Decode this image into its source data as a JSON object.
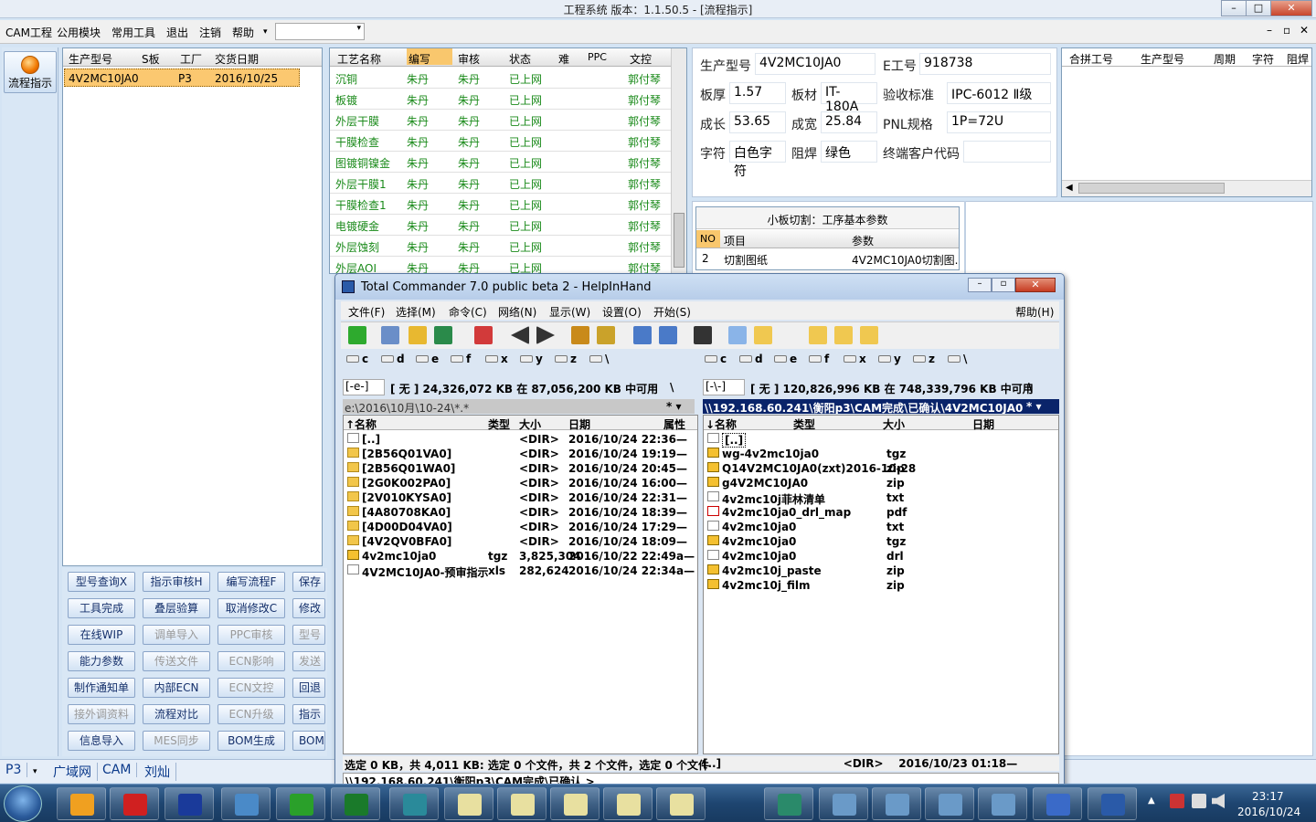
{
  "app": {
    "title": "工程系统   版本：1.1.50.5 - [流程指示]",
    "min": "–",
    "max": "□",
    "close": "✕"
  },
  "menu": [
    "CAM工程",
    "公用模块",
    "常用工具",
    "退出",
    "注销",
    "帮助"
  ],
  "leftnav": {
    "label": "流程指示"
  },
  "order_table": {
    "headers": [
      "生产型号",
      "S板",
      "工厂",
      "交货日期"
    ],
    "row": [
      "4V2MC10JA0",
      "",
      "P3",
      "2016/10/25"
    ]
  },
  "process_table": {
    "headers": [
      "工艺名称",
      "编写",
      "审核",
      "状态",
      "难",
      "PPC",
      "文控"
    ],
    "rows": [
      [
        "沉铜",
        "朱丹",
        "朱丹",
        "已上网",
        "",
        "",
        "郭付琴"
      ],
      [
        "板镀",
        "朱丹",
        "朱丹",
        "已上网",
        "",
        "",
        "郭付琴"
      ],
      [
        "外层干膜",
        "朱丹",
        "朱丹",
        "已上网",
        "",
        "",
        "郭付琴"
      ],
      [
        "干膜检查",
        "朱丹",
        "朱丹",
        "已上网",
        "",
        "",
        "郭付琴"
      ],
      [
        "图镀铜镍金",
        "朱丹",
        "朱丹",
        "已上网",
        "",
        "",
        "郭付琴"
      ],
      [
        "外层干膜1",
        "朱丹",
        "朱丹",
        "已上网",
        "",
        "",
        "郭付琴"
      ],
      [
        "干膜检查1",
        "朱丹",
        "朱丹",
        "已上网",
        "",
        "",
        "郭付琴"
      ],
      [
        "电镀硬金",
        "朱丹",
        "朱丹",
        "已上网",
        "",
        "",
        "郭付琴"
      ],
      [
        "外层蚀刻",
        "朱丹",
        "朱丹",
        "已上网",
        "",
        "",
        "郭付琴"
      ],
      [
        "外层AOI",
        "朱丹",
        "朱丹",
        "已上网",
        "",
        "",
        "郭付琴"
      ]
    ]
  },
  "buttons": [
    [
      "型号查询X",
      "指示审核H",
      "编写流程F",
      "保存信"
    ],
    [
      "工具完成",
      "叠层验算",
      "取消修改C",
      "修改信"
    ],
    [
      "在线WIP",
      "调单导入",
      "PPC审核",
      "型号上"
    ],
    [
      "能力参数",
      "传送文件",
      "ECN影响",
      "发送指"
    ],
    [
      "制作通知单",
      "内部ECN",
      "ECN文控",
      "回退审"
    ],
    [
      "接外调资料",
      "流程对比",
      "ECN升级",
      "指示核"
    ],
    [
      "信息导入",
      "MES同步",
      "BOM生成",
      "BOM参数"
    ]
  ],
  "disabled_buttons": [
    "调单导入",
    "PPC审核",
    "型号上",
    "传送文件",
    "ECN影响",
    "发送指",
    "ECN文控",
    "接外调资料",
    "ECN升级",
    "MES同步"
  ],
  "info": {
    "l_prod": "生产型号",
    "v_prod": "4V2MC10JA0",
    "l_e": "E工号",
    "v_e": "918738",
    "l_thick": "板厚",
    "v_thick": "1.57",
    "l_mat": "板材",
    "v_mat": "IT-180A",
    "l_std": "验收标准",
    "v_std": "IPC-6012 Ⅱ级",
    "l_len": "成长",
    "v_len": "53.65",
    "l_wid": "成宽",
    "v_wid": "25.84",
    "l_pnl": "PNL规格",
    "v_pnl": "1P=72U",
    "l_char": "字符",
    "v_char": "白色字符",
    "l_mask": "阻焊",
    "v_mask": "绿色",
    "l_cust": "终端客户代码",
    "v_cust": ""
  },
  "merge_table": {
    "headers": [
      "合拼工号",
      "生产型号",
      "周期",
      "字符",
      "阻焊"
    ]
  },
  "cut": {
    "title": "小板切割：工序基本参数",
    "headers": [
      "NO",
      "项目",
      "参数"
    ],
    "row": [
      "2",
      "切割图纸",
      "4V2MC10JA0切割图."
    ]
  },
  "bottom_tabs": [
    "P3",
    "广域网",
    "CAM",
    "刘灿"
  ],
  "tc": {
    "title": "Total Commander 7.0 public beta 2 - HelpInHand",
    "menu": [
      "文件(F)",
      "选择(M)",
      "命令(C)",
      "网络(N)",
      "显示(W)",
      "设置(O)",
      "开始(S)"
    ],
    "help": "帮助(H)",
    "left": {
      "drive": "[-e-]",
      "free": "[ 无 ]  24,326,072 KB 在 87,056,200 KB 中可用",
      "path": "e:\\2016\\10月\\10-24\\*.*",
      "headers": [
        "↑名称",
        "类型",
        "大小",
        "日期",
        "属性"
      ],
      "rows": [
        [
          "[..]",
          "",
          "<DIR>",
          "2016/10/24 22:36",
          "—"
        ],
        [
          "[2B56Q01VA0]",
          "",
          "<DIR>",
          "2016/10/24 19:19",
          "—"
        ],
        [
          "[2B56Q01WA0]",
          "",
          "<DIR>",
          "2016/10/24 20:45",
          "—"
        ],
        [
          "[2G0K002PA0]",
          "",
          "<DIR>",
          "2016/10/24 16:00",
          "—"
        ],
        [
          "[2V010KYSA0]",
          "",
          "<DIR>",
          "2016/10/24 22:31",
          "—"
        ],
        [
          "[4A80708KA0]",
          "",
          "<DIR>",
          "2016/10/24 18:39",
          "—"
        ],
        [
          "[4D00D04VA0]",
          "",
          "<DIR>",
          "2016/10/24 17:29",
          "—"
        ],
        [
          "[4V2QV0BFA0]",
          "",
          "<DIR>",
          "2016/10/24 18:09",
          "—"
        ],
        [
          "4v2mc10ja0",
          "tgz",
          "3,825,304",
          "2016/10/22 22:49",
          "a—"
        ],
        [
          "4V2MC10JA0-预审指示",
          "xls",
          "282,624",
          "2016/10/24 22:34",
          "a—"
        ]
      ]
    },
    "right": {
      "drive": "[-\\-]",
      "free": "[ 无 ]  120,826,996 KB 在 748,339,796 KB 中可用",
      "path": "\\\\192.168.60.241\\衡阳p3\\CAM完成\\已确认\\4V2MC10JA0.zip",
      "headers": [
        "↓名称",
        "类型",
        "大小",
        "日期"
      ],
      "rows": [
        [
          "[..]",
          ""
        ],
        [
          "wg-4v2mc10ja0",
          "tgz"
        ],
        [
          "Q14V2MC10JA0(zxt)2016-10-28",
          "zip"
        ],
        [
          "g4V2MC10JA0",
          "zip"
        ],
        [
          "4v2mc10j菲林清单",
          "txt"
        ],
        [
          "4v2mc10ja0_drl_map",
          "pdf"
        ],
        [
          "4v2mc10ja0",
          "txt"
        ],
        [
          "4v2mc10ja0",
          "tgz"
        ],
        [
          "4v2mc10ja0",
          "drl"
        ],
        [
          "4v2mc10j_paste",
          "zip"
        ],
        [
          "4v2mc10j_film",
          "zip"
        ]
      ]
    },
    "status_left": "选定 0 KB，共 4,011 KB: 选定 0 个文件，共 2 个文件，选定 0 个文件",
    "status_right": "[..]                                <DIR>    2016/10/23 01:18—",
    "cmdline": "\\\\192.168.60.241\\衡阳p3\\CAM完成\\已确认 >",
    "drives_left": [
      "c",
      "d",
      "e",
      "f",
      "x",
      "y",
      "z",
      "\\"
    ],
    "drives_right": [
      "c",
      "d",
      "e",
      "f",
      "x",
      "y",
      "z",
      "\\"
    ]
  },
  "clock": {
    "time": "23:17",
    "date": "2016/10/24"
  }
}
